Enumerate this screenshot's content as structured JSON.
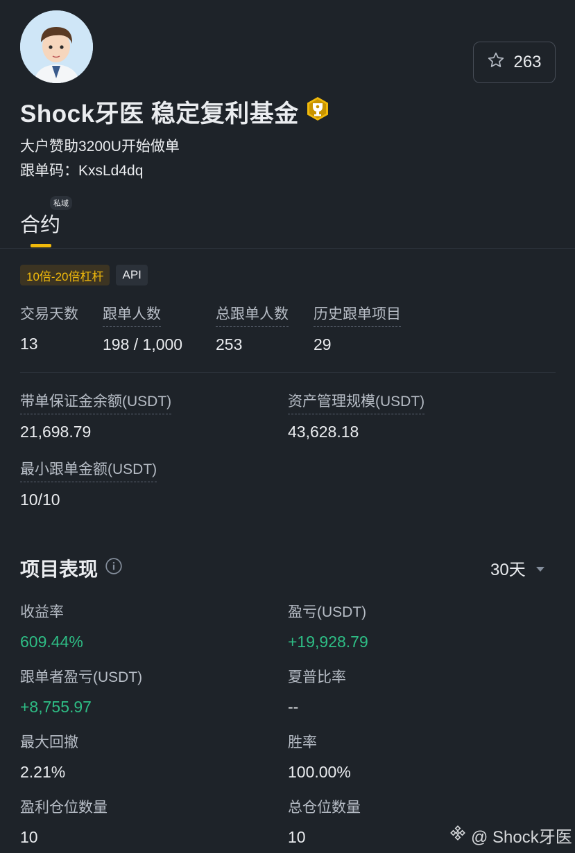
{
  "profile": {
    "favorites_count": "263",
    "name": "Shock牙医 稳定复利基金",
    "description": "大户赞助3200U开始做单",
    "code_label": "跟单码：",
    "code_value": "KxsLd4dq"
  },
  "tab": {
    "label": "合约",
    "badge": "私域"
  },
  "tags": [
    "10倍-20倍杠杆",
    "API"
  ],
  "stats_top": [
    {
      "label": "交易天数",
      "value": "13"
    },
    {
      "label": "跟单人数",
      "value": "198 / 1,000"
    },
    {
      "label": "总跟单人数",
      "value": "253"
    },
    {
      "label": "历史跟单项目",
      "value": "29"
    }
  ],
  "stats_mid": [
    {
      "label": "带单保证金余额(USDT)",
      "value": "21,698.79"
    },
    {
      "label": "资产管理规模(USDT)",
      "value": "43,628.18"
    },
    {
      "label": "最小跟单金额(USDT)",
      "value": "10/10"
    }
  ],
  "performance": {
    "title": "项目表现",
    "period": "30天",
    "items": [
      {
        "label": "收益率",
        "value": "609.44%"
      },
      {
        "label": "盈亏(USDT)",
        "value": "+19,928.79"
      },
      {
        "label": "跟单者盈亏(USDT)",
        "value": "+8,755.97"
      },
      {
        "label": "夏普比率",
        "value": "--"
      },
      {
        "label": "最大回撤",
        "value": "2.21%"
      },
      {
        "label": "胜率",
        "value": "100.00%"
      },
      {
        "label": "盈利仓位数量",
        "value": "10"
      },
      {
        "label": "总仓位数量",
        "value": "10"
      }
    ]
  },
  "watermark": "@ Shock牙医",
  "colors": {
    "accent": "#f0b90b",
    "positive": "#2ebd85",
    "background": "#1e2329"
  }
}
